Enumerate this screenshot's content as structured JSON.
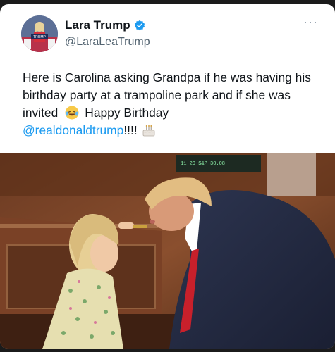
{
  "tweet": {
    "author": {
      "display_name": "Lara Trump",
      "handle": "@LaraLeaTrump",
      "verified": true,
      "avatar_sign_text": "TRUMP"
    },
    "text_parts": [
      "Here is Carolina asking Grandpa if he was having his birthday party at a trampoline park and if she was invited",
      "Happy Birthday",
      "@realdonaldtrump",
      "!!!!"
    ],
    "emojis": [
      "laughing-crying-emoji",
      "birthday-cake-emoji"
    ],
    "more_label": "···",
    "photo": {
      "screen_ticker": "11.20   S&P   30.08",
      "description_icon": "photo"
    }
  },
  "colors": {
    "accent": "#1d9bf0",
    "text": "#0f1419",
    "muted": "#536471"
  }
}
